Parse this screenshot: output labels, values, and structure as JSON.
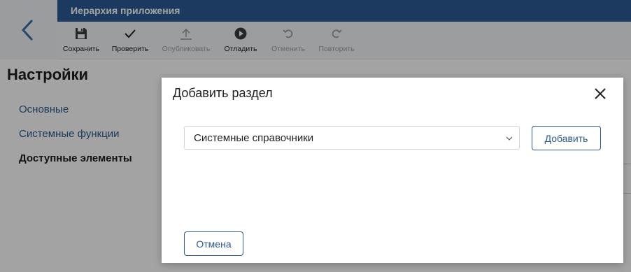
{
  "header": {
    "title": "Иерархия приложения"
  },
  "toolbar": {
    "save": {
      "label": "Сохранить",
      "icon": "save-icon"
    },
    "check": {
      "label": "Проверить",
      "icon": "check-icon"
    },
    "publish": {
      "label": "Опубликовать",
      "icon": "publish-icon",
      "disabled": true
    },
    "debug": {
      "label": "Отладить",
      "icon": "debug-icon"
    },
    "undo": {
      "label": "Отменить",
      "icon": "undo-icon",
      "disabled": true
    },
    "redo": {
      "label": "Повторить",
      "icon": "redo-icon",
      "disabled": true
    }
  },
  "page": {
    "heading": "Настройки"
  },
  "nav": {
    "items": [
      {
        "label": "Основные",
        "active": false
      },
      {
        "label": "Системные функции",
        "active": false
      },
      {
        "label": "Доступные элементы",
        "active": true
      }
    ]
  },
  "modal": {
    "title": "Добавить раздел",
    "select_value": "Системные справочники",
    "add_label": "Добавить",
    "cancel_label": "Отмена"
  },
  "colors": {
    "brand": "#2d5c95",
    "link": "#2c5a8c",
    "overlay": "rgba(0,0,0,0.36)"
  }
}
